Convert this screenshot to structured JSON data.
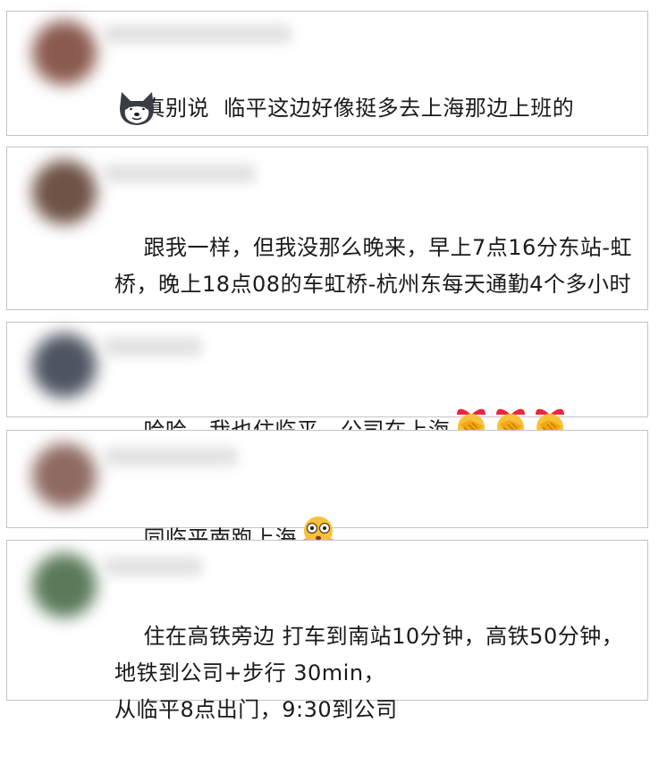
{
  "comments": [
    {
      "text": "真别说  临平这边好像挺多去上海那边上班的",
      "avatar_color": "#8a5a4e",
      "emojis": [],
      "sticker": "husky-doge-icon"
    },
    {
      "text": "跟我一样，但我没那么晚来，早上7点16分东站-虹桥，晚上18点08的车虹桥-杭州东每天通勤4个多小时",
      "avatar_color": "#6e5246",
      "emojis": [],
      "sticker": ""
    },
    {
      "text": "哈哈，我也住临平，公司在上海",
      "avatar_color": "#4e5562",
      "emojis": [
        "handshake-icon",
        "handshake-icon",
        "handshake-icon"
      ],
      "sticker": ""
    },
    {
      "text": "同临平南跑上海",
      "avatar_color": "#8e6a62",
      "emojis": [
        "flushed-face-icon"
      ],
      "sticker": ""
    },
    {
      "text": "住在高铁旁边 打车到南站10分钟，高铁50分钟，地铁到公司+步行 30min，\n从临平8点出门，9:30到公司",
      "avatar_color": "#5a7a5a",
      "emojis": [],
      "sticker": ""
    }
  ]
}
